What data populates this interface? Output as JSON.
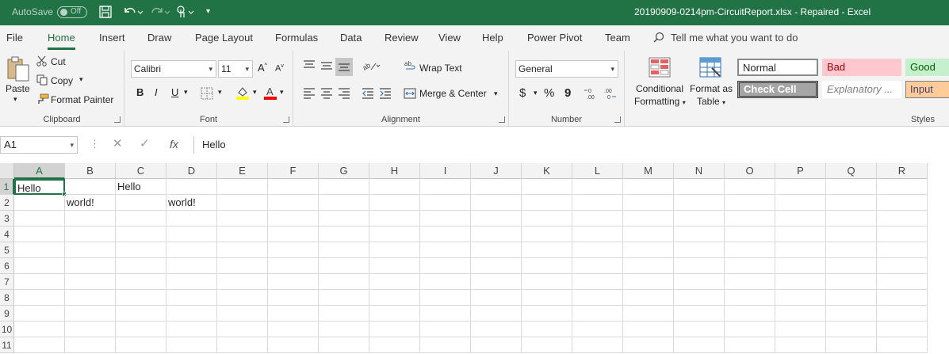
{
  "titlebar": {
    "autosave_label": "AutoSave",
    "autosave_state": "Off",
    "document_title": "20190909-0214pm-CircuitReport.xlsx  -  Repaired  -  Excel"
  },
  "tabs": [
    {
      "label": "File"
    },
    {
      "label": "Home"
    },
    {
      "label": "Insert"
    },
    {
      "label": "Draw"
    },
    {
      "label": "Page Layout"
    },
    {
      "label": "Formulas"
    },
    {
      "label": "Data"
    },
    {
      "label": "Review"
    },
    {
      "label": "View"
    },
    {
      "label": "Help"
    },
    {
      "label": "Power Pivot"
    },
    {
      "label": "Team"
    }
  ],
  "tellme_placeholder": "Tell me what you want to do",
  "ribbon": {
    "clipboard": {
      "label": "Clipboard",
      "paste": "Paste",
      "cut": "Cut",
      "copy": "Copy",
      "format_painter": "Format Painter"
    },
    "font": {
      "label": "Font",
      "family": "Calibri",
      "size": "11",
      "bold": "B",
      "italic": "I",
      "underline": "U",
      "font_color_letter": "A",
      "grow": "A",
      "shrink": "A"
    },
    "alignment": {
      "label": "Alignment",
      "wrap_text": "Wrap Text",
      "merge_center": "Merge & Center"
    },
    "number": {
      "label": "Number",
      "format": "General",
      "currency": "$",
      "percent": "%",
      "comma": "9"
    },
    "styles": {
      "label": "Styles",
      "conditional_formatting": [
        "Conditional",
        "Formatting"
      ],
      "format_as_table": [
        "Format as",
        "Table"
      ],
      "cells": [
        {
          "name": "Normal"
        },
        {
          "name": "Bad"
        },
        {
          "name": "Good"
        },
        {
          "name": "Check Cell"
        },
        {
          "name": "Explanatory ..."
        },
        {
          "name": "Input"
        }
      ]
    }
  },
  "formula_bar": {
    "name_box": "A1",
    "fx": "fx",
    "content": "Hello"
  },
  "sheet": {
    "columns": [
      "A",
      "B",
      "C",
      "D",
      "E",
      "F",
      "G",
      "H",
      "I",
      "J",
      "K",
      "L",
      "M",
      "N",
      "O",
      "P",
      "Q",
      "R"
    ],
    "rows": [
      "1",
      "2",
      "3",
      "4",
      "5",
      "6",
      "7",
      "8",
      "9",
      "10",
      "11"
    ],
    "active_cell": "A1",
    "cells": [
      {
        "ref": "A1",
        "value": "Hello"
      },
      {
        "ref": "C1",
        "value": "Hello"
      },
      {
        "ref": "B2",
        "value": "world!"
      },
      {
        "ref": "D2",
        "value": "world!"
      }
    ]
  },
  "colors": {
    "accent": "#217346",
    "style_bad_bg": "#ffc7ce",
    "style_bad_fg": "#9c0006",
    "style_good_bg": "#c6efce",
    "style_good_fg": "#006100",
    "style_check_bg": "#a5a5a5",
    "style_input_bg": "#ffcc99",
    "style_input_fg": "#3f3f76"
  }
}
